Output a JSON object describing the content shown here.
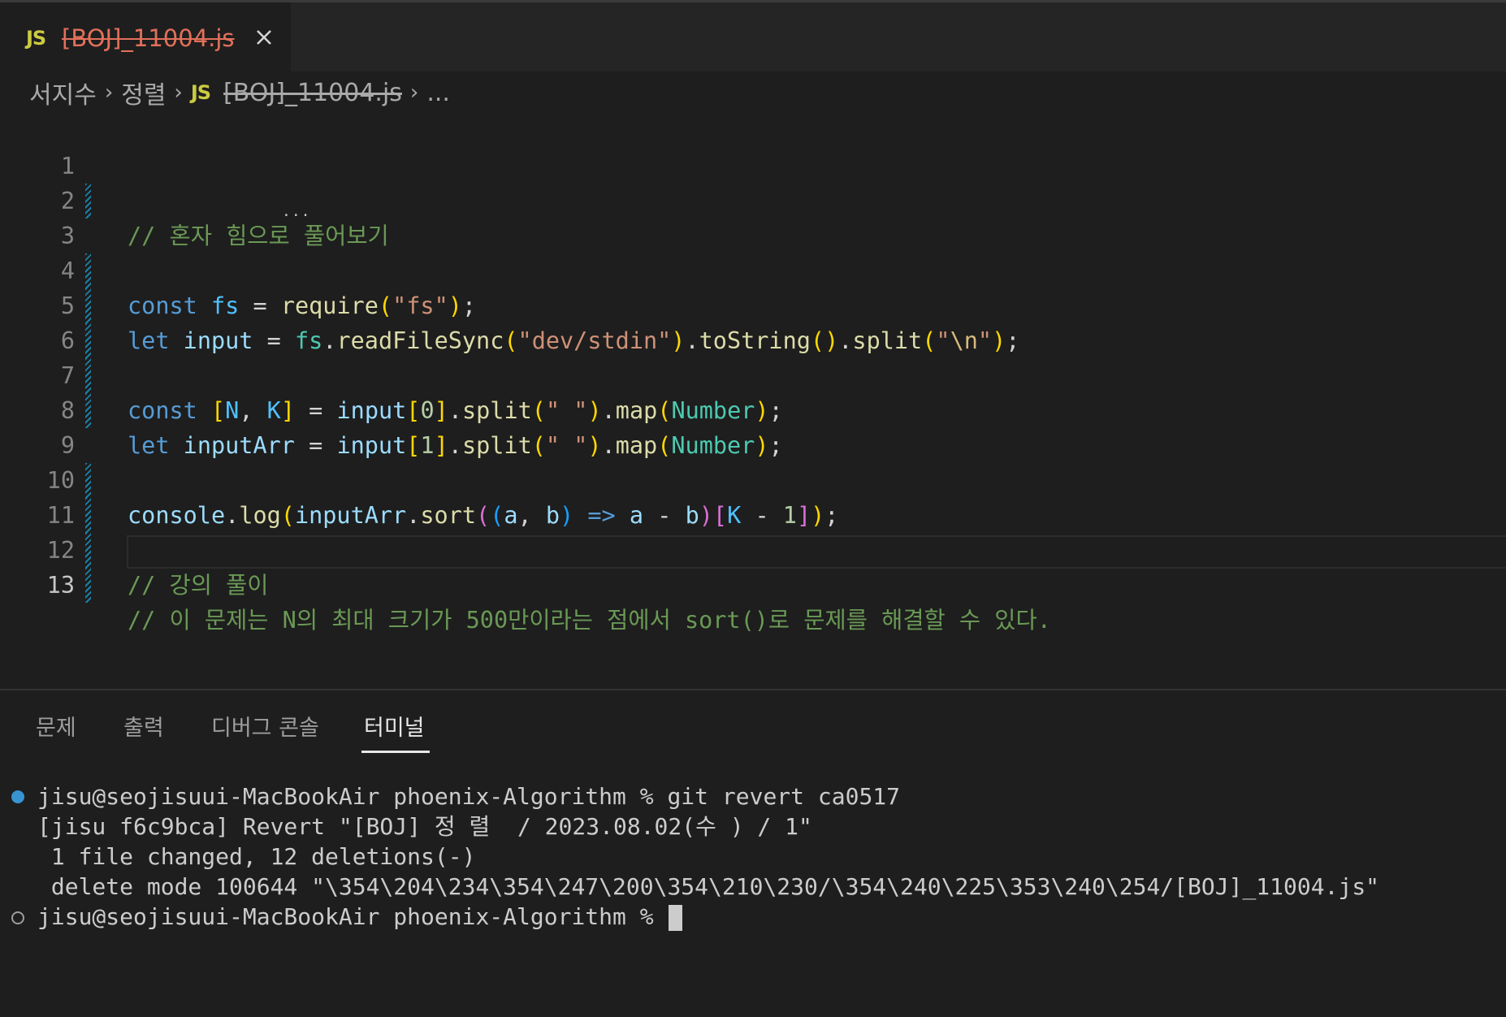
{
  "tab": {
    "badge": "JS",
    "title": "[BOJ]_11004.js"
  },
  "breadcrumb": {
    "folder1": "서지수",
    "folder2": "정렬",
    "badge": "JS",
    "file": "[BOJ]_11004.js",
    "more": "..."
  },
  "editor": {
    "line_numbers": [
      "1",
      "2",
      "3",
      "4",
      "5",
      "6",
      "7",
      "8",
      "9",
      "10",
      "11",
      "12",
      "13"
    ],
    "comment_1": "// 혼자 힘으로 풀어보기",
    "comment_11": "// 강의 풀이",
    "comment_12": "// 이 문제는 N의 최대 크기가 500만이라는 점에서 sort()로 문제를 해결할 수 있다."
  },
  "panel": {
    "tabs": [
      "문제",
      "출력",
      "디버그 콘솔",
      "터미널"
    ],
    "active_tab": "터미널"
  },
  "terminal": {
    "lines": [
      "jisu@seojisuui-MacBookAir phoenix-Algorithm % git revert ca0517",
      "[jisu f6c9bca] Revert \"[BOJ] 정 렬  / 2023.08.02(수 ) / 1\"",
      " 1 file changed, 12 deletions(-)",
      " delete mode 100644 \"\\354\\204\\234\\354\\247\\200\\354\\210\\230/\\354\\240\\225\\353\\240\\254/[BOJ]_11004.js\"",
      "jisu@seojisuui-MacBookAir phoenix-Algorithm % "
    ]
  },
  "colors": {
    "accent_blue": "#3794d1",
    "deleted_file_red": "#e2705a",
    "js_yellow": "#cbcb41"
  }
}
